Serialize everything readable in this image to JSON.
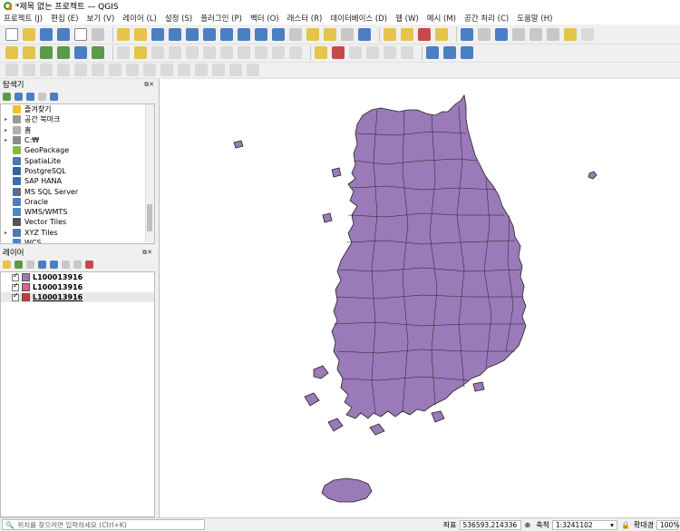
{
  "window": {
    "title": "*제목 없는 프로젝트 — QGIS"
  },
  "menu": [
    "프로젝트 (J)",
    "편집 (E)",
    "보기 (V)",
    "레이어 (L)",
    "설정 (S)",
    "플러그인 (P)",
    "벡터 (O)",
    "래스터 (R)",
    "데이터베이스 (D)",
    "웹 (W)",
    "메시 (M)",
    "공간 처리 (C)",
    "도움말 (H)"
  ],
  "browser": {
    "title": "탐색기",
    "items": [
      {
        "label": "즐겨찾기",
        "icon": "star-icon",
        "color": "#f2c12e",
        "expand": false
      },
      {
        "label": "공간 북마크",
        "icon": "bookmark-icon",
        "color": "#9a9a9a",
        "expand": true
      },
      {
        "label": "홈",
        "icon": "home-icon",
        "color": "#b0b0b0",
        "expand": true
      },
      {
        "label": "C:₩",
        "icon": "drive-icon",
        "color": "#8c8c8c",
        "expand": true
      },
      {
        "label": "GeoPackage",
        "icon": "geopackage-icon",
        "color": "#8bb83b",
        "expand": false
      },
      {
        "label": "SpatiaLite",
        "icon": "spatialite-icon",
        "color": "#4b77b3",
        "expand": false
      },
      {
        "label": "PostgreSQL",
        "icon": "postgresql-icon",
        "color": "#336791",
        "expand": false
      },
      {
        "label": "SAP HANA",
        "icon": "sap-hana-icon",
        "color": "#3c6db0",
        "expand": false
      },
      {
        "label": "MS SQL Server",
        "icon": "mssql-icon",
        "color": "#5b6a8a",
        "expand": false
      },
      {
        "label": "Oracle",
        "icon": "oracle-icon",
        "color": "#4c7fc0",
        "expand": false
      },
      {
        "label": "WMS/WMTS",
        "icon": "wms-icon",
        "color": "#4a8ac0",
        "expand": false
      },
      {
        "label": "Vector Tiles",
        "icon": "vector-tiles-icon",
        "color": "#555555",
        "expand": false
      },
      {
        "label": "XYZ Tiles",
        "icon": "xyz-tiles-icon",
        "color": "#5577aa",
        "expand": true
      },
      {
        "label": "WCS",
        "icon": "wcs-icon",
        "color": "#4a8ac0",
        "expand": false
      }
    ]
  },
  "layers": {
    "title": "레이어",
    "items": [
      {
        "label": "L100013916",
        "color": "#9a7ab8",
        "selected": false
      },
      {
        "label": "L100013916",
        "color": "#e0608c",
        "selected": false
      },
      {
        "label": "L100013916",
        "color": "#cc3a3a",
        "selected": true
      }
    ]
  },
  "map": {
    "fill_color": "#9a7ab8",
    "stroke_color": "#222222"
  },
  "status": {
    "locator_placeholder": "위치를 찾으려면 입력하세요 (Ctrl+K)",
    "coord_label": "좌표",
    "coord_value": "536593,214336",
    "scale_label": "축척",
    "scale_value": "1:3241102",
    "magnifier_label": "확대경",
    "magnifier_value": "100%"
  }
}
